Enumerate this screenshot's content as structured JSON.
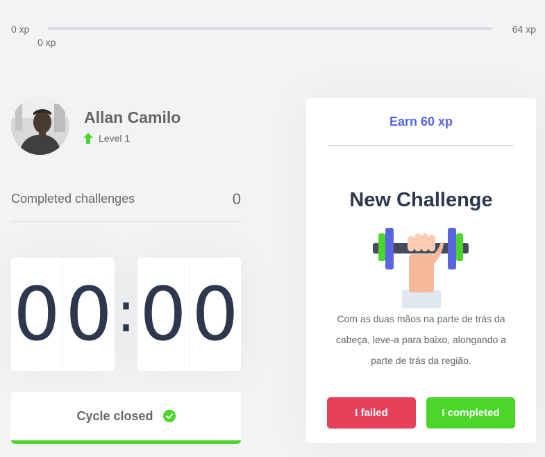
{
  "xp": {
    "start_label": "0 xp",
    "end_label": "64 xp",
    "current_label": "0 xp",
    "progress_fraction": 0,
    "fill_color": "#4cd62b"
  },
  "profile": {
    "name": "Allan Camilo",
    "level_label": "Level 1",
    "level_icon": "level-up-arrow-icon"
  },
  "completed": {
    "label": "Completed challenges",
    "value": "0"
  },
  "countdown": {
    "minute_left": "0",
    "minute_right": "0",
    "separator": ":",
    "second_left": "0",
    "second_right": "0"
  },
  "cycle": {
    "label": "Cycle closed",
    "icon": "check-circle-icon",
    "accent_color": "#4cd62b"
  },
  "challenge": {
    "reward": "Earn 60 xp",
    "title": "New Challenge",
    "image_icon": "dumbbell-hand-icon",
    "description": "Com as duas mãos na parte de trás da cabeça, leve-a para baixo, alongando a parte de trás da região.",
    "failed_label": "I failed",
    "completed_label": "I completed",
    "failed_color": "#e83f5b",
    "completed_color": "#4cd62b",
    "accent_color": "#5965e0"
  }
}
